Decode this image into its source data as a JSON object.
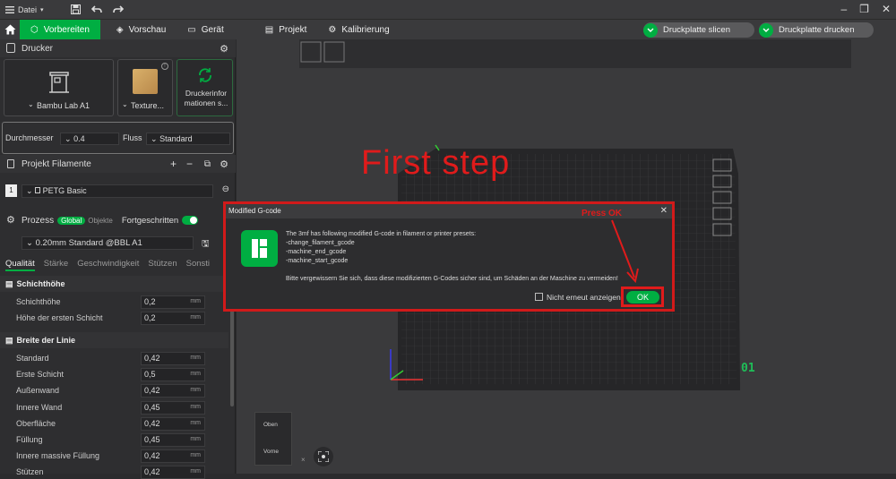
{
  "titlebar": {
    "menu_label": "Datei"
  },
  "tabs": [
    {
      "label": "Vorbereiten"
    },
    {
      "label": "Vorschau"
    },
    {
      "label": "Gerät"
    },
    {
      "label": "Projekt"
    },
    {
      "label": "Kalibrierung"
    }
  ],
  "actions": {
    "slice": "Druckplatte slicen",
    "print": "Druckplatte drucken"
  },
  "printer": {
    "section": "Drucker",
    "name": "Bambu Lab A1",
    "texture": "Texture...",
    "info": "Druckerinfor\nmationen s...",
    "diameter_label": "Durchmesser",
    "diameter_value": "0.4",
    "flow_label": "Fluss",
    "flow_value": "Standard"
  },
  "filament": {
    "section": "Projekt Filamente",
    "slot": "1",
    "name": "PETG Basic"
  },
  "process": {
    "section": "Prozess",
    "global": "Global",
    "objects": "Objekte",
    "advanced": "Fortgeschritten",
    "preset": "0.20mm Standard @BBL A1",
    "subtabs": [
      "Qualität",
      "Stärke",
      "Geschwindigkeit",
      "Stützen",
      "Sonsti"
    ],
    "groups": [
      {
        "title": "Schichthöhe",
        "rows": [
          {
            "label": "Schichthöhe",
            "value": "0,2",
            "unit": "mm"
          },
          {
            "label": "Höhe der ersten Schicht",
            "value": "0,2",
            "unit": "mm"
          }
        ]
      },
      {
        "title": "Breite der Linie",
        "rows": [
          {
            "label": "Standard",
            "value": "0,42",
            "unit": "mm"
          },
          {
            "label": "Erste Schicht",
            "value": "0,5",
            "unit": "mm"
          },
          {
            "label": "Außenwand",
            "value": "0,42",
            "unit": "mm"
          },
          {
            "label": "Innere Wand",
            "value": "0,45",
            "unit": "mm"
          },
          {
            "label": "Oberfläche",
            "value": "0,42",
            "unit": "mm"
          },
          {
            "label": "Füllung",
            "value": "0,45",
            "unit": "mm"
          },
          {
            "label": "Innere massive Füllung",
            "value": "0,42",
            "unit": "mm"
          },
          {
            "label": "Stützen",
            "value": "0,42",
            "unit": "mm"
          }
        ]
      }
    ]
  },
  "annotations": {
    "first_step": "First step",
    "press_ok": "Press OK"
  },
  "view_cube": {
    "top": "Oben",
    "front": "Vorne"
  },
  "plate_number": "01",
  "modal": {
    "title": "Modified G-code",
    "lines": [
      "The 3mf has following modified G-code in filament or printer presets:",
      "-change_filament_gcode",
      "-machine_end_gcode",
      "-machine_start_gcode"
    ],
    "warning": "Bitte vergewissern Sie sich, dass diese modifizierten G-Codes sicher sind, um Schäden an der Maschine zu vermeiden!",
    "checkbox": "Nicht erneut anzeigen",
    "ok": "OK"
  },
  "colors": {
    "accent": "#00ae42",
    "annotation": "#e01b1b"
  }
}
